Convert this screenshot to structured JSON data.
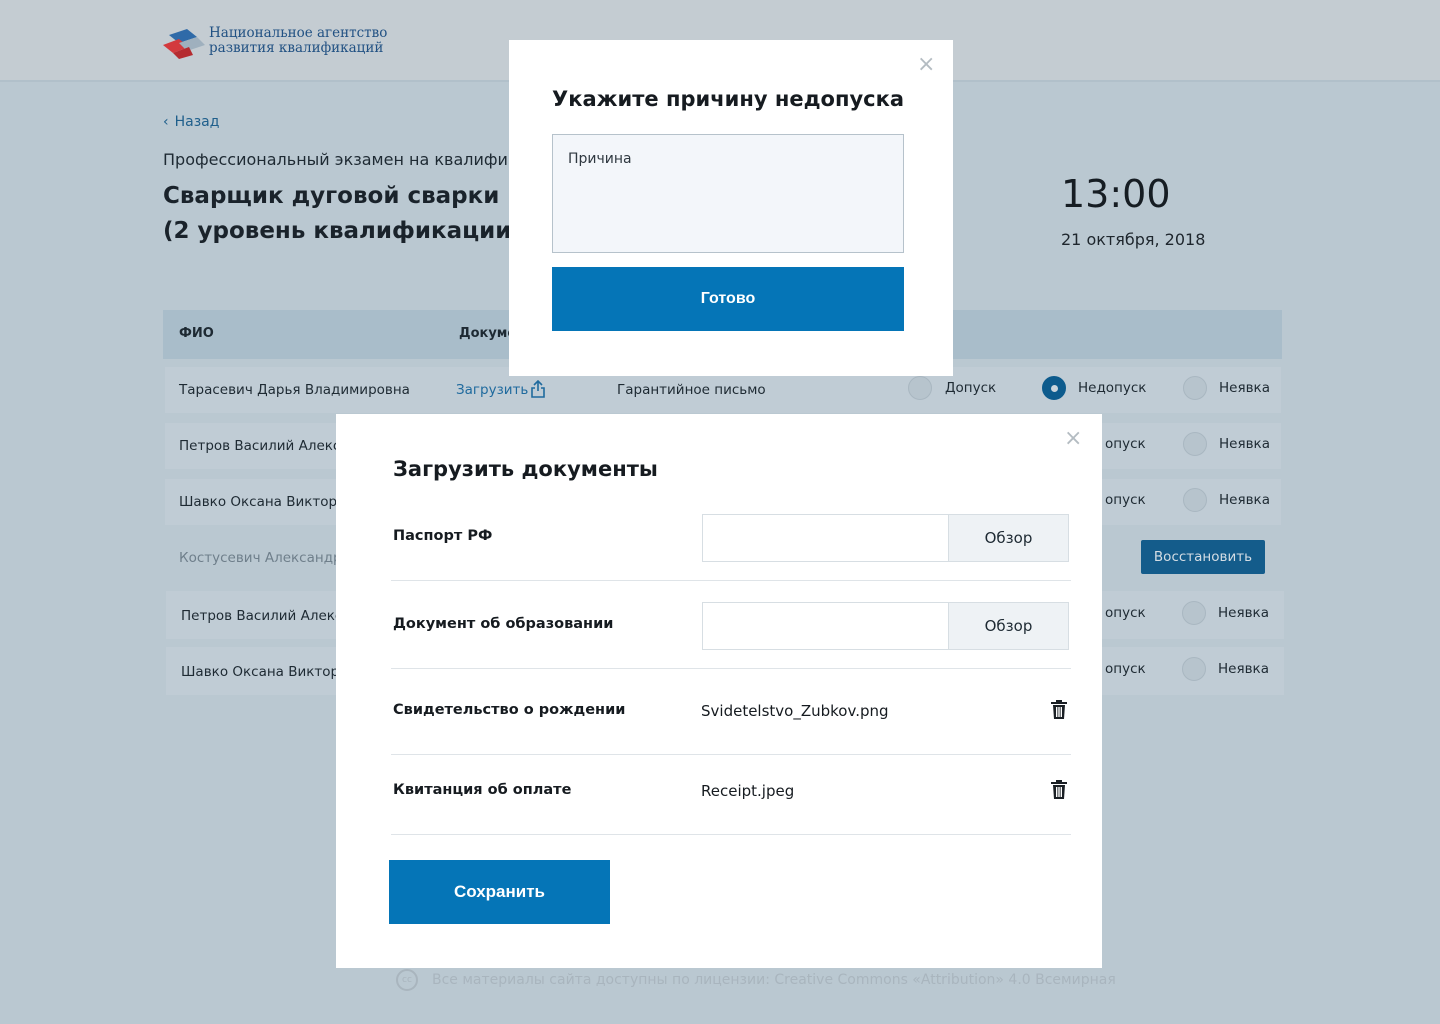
{
  "header": {
    "logo_line1": "Национальное агентство",
    "logo_line2": "развития квалификаций"
  },
  "back_label": "Назад",
  "exam": {
    "subtitle": "Профессиональный экзамен на квалифик",
    "title_line1": "Сварщик дуговой сварки плав",
    "title_line2": "(2 уровень квалификации)",
    "time": "13:00",
    "date": "21 октября, 2018"
  },
  "table": {
    "col_fio": "ФИО",
    "col_docs": "Докуме",
    "rows": [
      {
        "name": "Тарасевич Дарья Владимировна",
        "upload": "Загрузить",
        "doc": "Гарантийное письмо",
        "opt1": "Допуск",
        "opt2": "Недопуск",
        "opt3": "Неявка"
      },
      {
        "name": "Петров Василий Алексее",
        "opt2": "опуск",
        "opt3": "Неявка"
      },
      {
        "name": "Шавко Оксана Викторов",
        "opt2": "опуск",
        "opt3": "Неявка"
      },
      {
        "name": "Костусевич Александр С",
        "restore": "Восстановить"
      },
      {
        "name": "Петров Василий Алексе",
        "opt2": "опуск",
        "opt3": "Неявка"
      },
      {
        "name": "Шавко Оксана Викторов",
        "opt2": "опуск",
        "opt3": "Неявка"
      }
    ]
  },
  "footer_text": "Все материалы сайта доступны по лицензии: Creative Commons «Attribution» 4.0 Всемирная",
  "footer_icon": "cc",
  "reason_modal": {
    "title": "Укажите причину недопуска",
    "placeholder": "Причина",
    "submit": "Готово",
    "close": "×"
  },
  "docs_modal": {
    "title": "Загрузить документы",
    "close": "×",
    "browse_label": "Обзор",
    "items": [
      {
        "label": "Паспорт РФ"
      },
      {
        "label": "Документ об образовании"
      },
      {
        "label": "Свидетельство о рождении",
        "file": "Svidetelstvo_Zubkov.png"
      },
      {
        "label": "Квитанция об оплате",
        "file": "Receipt.jpeg"
      }
    ],
    "save": "Сохранить"
  },
  "colors": {
    "primary": "#0575b7",
    "overlay_bg": "#bac8d1"
  }
}
